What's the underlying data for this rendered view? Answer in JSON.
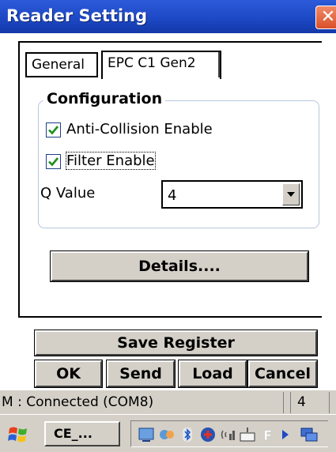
{
  "window": {
    "title": "Reader Setting",
    "close_label": "✕"
  },
  "tabs": [
    {
      "label": "General",
      "selected": false
    },
    {
      "label": "EPC C1 Gen2",
      "selected": true
    }
  ],
  "configuration": {
    "title": "Configuration",
    "anti_collision": {
      "label": "Anti-Collision Enable",
      "checked": true
    },
    "filter": {
      "label": "Filter Enable",
      "checked": true
    },
    "q_value": {
      "label": "Q Value",
      "selected": "4"
    }
  },
  "buttons": {
    "details": "Details....",
    "save_register": "Save Register",
    "ok": "OK",
    "send": "Send",
    "load": "Load",
    "cancel": "Cancel"
  },
  "status": {
    "connection": "M : Connected (COM8)",
    "value": "4"
  },
  "taskbar": {
    "task_button": "CE_...",
    "tray_icons": [
      "network-icon",
      "sync-icon",
      "bluetooth-icon",
      "rfid-icon",
      "signal-icon",
      "keyboard-icon",
      "f-icon",
      "arrow-right-icon",
      "desktop-icon"
    ]
  },
  "colors": {
    "titlebar": "#1d49c6",
    "check": "#1c8c1c",
    "chrome": "#d4d0c8"
  }
}
